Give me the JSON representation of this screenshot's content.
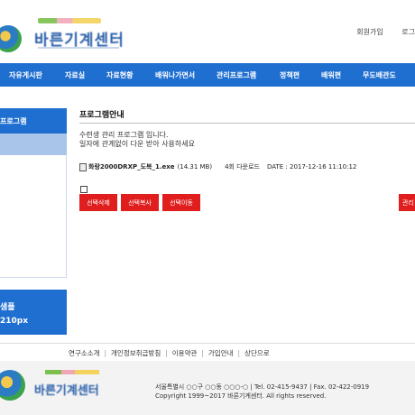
{
  "header": {
    "logo_text": "바른기계센터",
    "links": [
      "회원가입",
      "로그"
    ]
  },
  "nav": {
    "items": [
      "자유게시판",
      "자료실",
      "자료현황",
      "배워나가면서",
      "관리프로그램",
      "정책편",
      "배워편",
      "무도배관도"
    ]
  },
  "sidebar": {
    "heading": "프로그램",
    "banner_line1": "샘플",
    "banner_line2": "210px"
  },
  "main": {
    "title": "프로그램안내",
    "desc_line1": "수련생 관리 프로그램 입니다.",
    "desc_line2": "일자에 관계없이 다운 받아 사용하세요",
    "file": {
      "name": "화랑2000DRXP_도복_1.exe",
      "size": "(14.31 MB)",
      "downloads": "4회 다운로드",
      "date": "DATE : 2017-12-16 11:10:12"
    },
    "buttons": [
      "선택삭제",
      "선택복사",
      "선택이동"
    ],
    "right_button": "관리"
  },
  "footer": {
    "links": [
      "연구소소개",
      "개인정보취급방침",
      "이용약관",
      "가입안내",
      "상단으로"
    ],
    "address": "서울특별시 ○○구 ○○동 ○○○-○  |  Tel. 02-415-9437  |  Fax. 02-422-0919",
    "copyright": "Copyright 1999~2017 바른기계센터. All rights reserved."
  },
  "colors": {
    "nav_blue": "#1f6fd1",
    "button_red": "#e01e1e",
    "sidebar_selected": "#a9c6ea"
  }
}
